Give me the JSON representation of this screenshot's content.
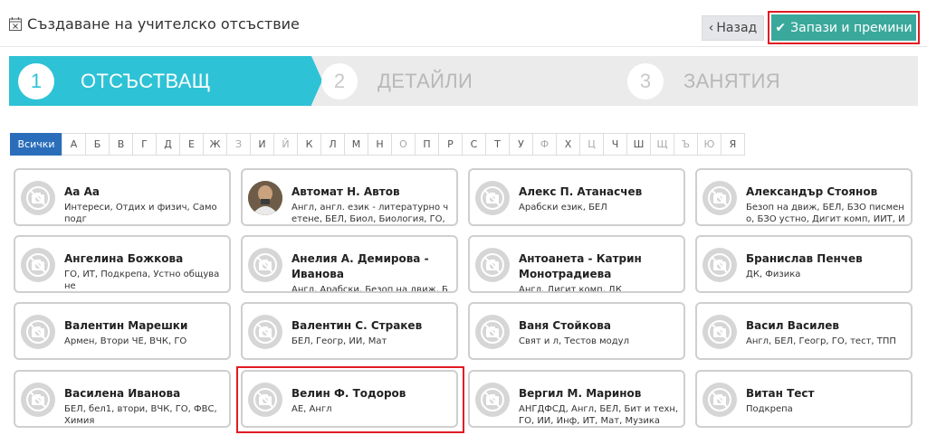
{
  "header": {
    "title": "Създаване на учителско отсъствие",
    "back_label": "Назад",
    "save_label": "Запази и премини"
  },
  "steps": [
    {
      "num": "1",
      "label": "ОТСЪСТВАЩ",
      "active": true
    },
    {
      "num": "2",
      "label": "ДЕТАЙЛИ",
      "active": false
    },
    {
      "num": "3",
      "label": "ЗАНЯТИЯ",
      "active": false
    }
  ],
  "alphabet": {
    "all_label": "Всички",
    "letters": [
      "А",
      "Б",
      "В",
      "Г",
      "Д",
      "Е",
      "Ж",
      "З",
      "И",
      "Й",
      "К",
      "Л",
      "М",
      "Н",
      "О",
      "П",
      "Р",
      "С",
      "Т",
      "У",
      "Ф",
      "Х",
      "Ц",
      "Ч",
      "Ш",
      "Щ",
      "Ъ",
      "Ю",
      "Я"
    ]
  },
  "teachers": [
    {
      "name": "Аа Аа",
      "subjects": "Интереси, Отдих и физич, Само подг"
    },
    {
      "name": "Автомат Н. Автов",
      "subjects": "Англ, англ. език - литературно ч етене, БЕЛ, Биол, Биология, ГО,"
    },
    {
      "name": "Алекс П. Атанасчев",
      "subjects": "Арабски език, БЕЛ"
    },
    {
      "name": "Александър Стоянов",
      "subjects": "Безоп на движ, БЕЛ, БЗО писмен о, БЗО устно, Дигит комп, ИИТ, И"
    },
    {
      "name": "Ангелина Божкова",
      "subjects": "ГО, ИТ, Подкрепа, Устно общува не"
    },
    {
      "name": "Анелия А. Демирова - Иванова",
      "subjects": "Англ, Арабски, Безоп на движ, Б"
    },
    {
      "name": "Антоанета - Катрин Монотрадиева",
      "subjects": "Англ, Дигит комп, ДК"
    },
    {
      "name": "Бранислав Пенчев",
      "subjects": "ДК, Физика"
    },
    {
      "name": "Валентин Марешки",
      "subjects": "Армен, Втори ЧЕ, ВЧК, ГО"
    },
    {
      "name": "Валентин С. Стракев",
      "subjects": "БЕЛ, Геогр, ИИ, Мат"
    },
    {
      "name": "Ваня Стойкова",
      "subjects": "Свят и л, Тестов модул"
    },
    {
      "name": "Васил Василев",
      "subjects": "Англ, БЕЛ, Геогр, ГО, тест, ТПП"
    },
    {
      "name": "Василена Иванова",
      "subjects": "БЕЛ, бел1, втори, ВЧК, ГО, ФВС, Химия"
    },
    {
      "name": "Велин Ф. Тодоров",
      "subjects": "АЕ, Англ"
    },
    {
      "name": "Вергил М. Маринов",
      "subjects": "АНГДФСД, Англ, БЕЛ, Бит и техн, ГО, ИИ, Инф, ИТ, Мат, Музика"
    },
    {
      "name": "Витан Тест",
      "subjects": "Подкрепа"
    }
  ],
  "colors": {
    "accent": "#2ec2d6",
    "save_button": "#3aa99c",
    "highlight": "#e11b23",
    "filter_active": "#2a6ebb"
  },
  "icons": {
    "title": "calendar-x-icon",
    "back": "chevron-left-icon",
    "save": "checkmark-icon",
    "avatar_placeholder": "no-photo-camera-icon"
  }
}
